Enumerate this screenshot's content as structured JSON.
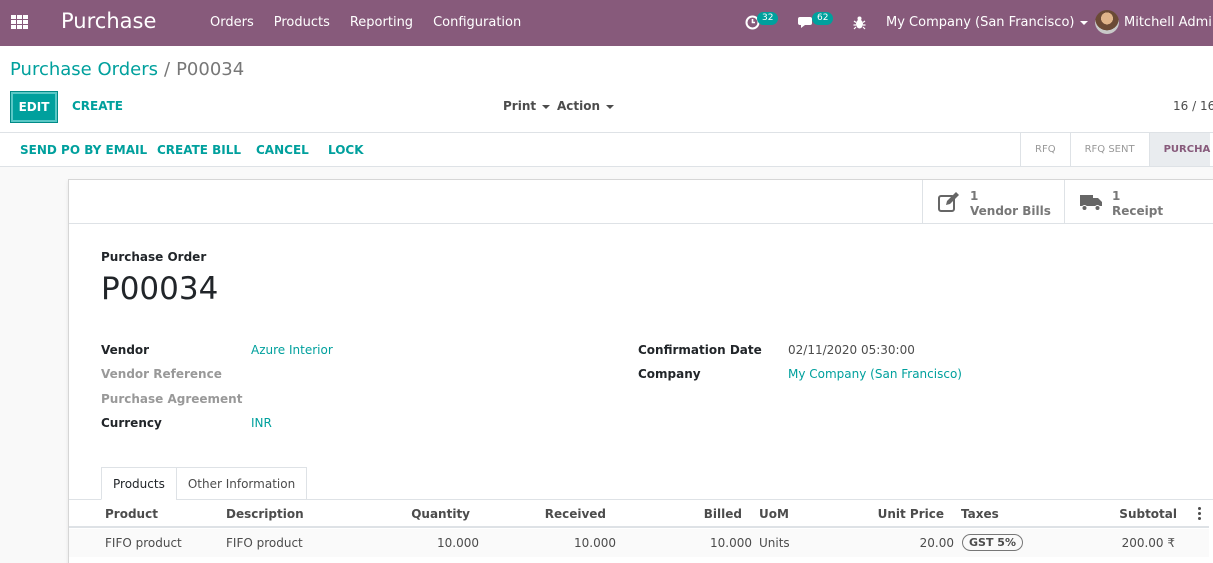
{
  "navbar": {
    "brand": "Purchase",
    "menu": [
      "Orders",
      "Products",
      "Reporting",
      "Configuration"
    ],
    "activity_count": "32",
    "message_count": "62",
    "company": "My Company (San Francisco)",
    "user": "Mitchell Admin"
  },
  "breadcrumb": {
    "parent": "Purchase Orders",
    "separator": "/",
    "current": "P00034"
  },
  "toolbar": {
    "edit": "EDIT",
    "create": "CREATE",
    "print": "Print",
    "action": "Action",
    "pager": "16 / 16"
  },
  "statusbar": {
    "buttons": [
      "SEND PO BY EMAIL",
      "CREATE BILL",
      "CANCEL",
      "LOCK"
    ],
    "stages": [
      "RFQ",
      "RFQ SENT",
      "PURCHA"
    ]
  },
  "smart_buttons": [
    {
      "count": "1",
      "label": "Vendor Bills",
      "icon": "pencil-square-icon"
    },
    {
      "count": "1",
      "label": "Receipt",
      "icon": "truck-icon"
    }
  ],
  "form": {
    "doc_type": "Purchase Order",
    "name": "P00034",
    "left_fields": [
      {
        "label": "Vendor",
        "value": "Azure Interior"
      },
      {
        "label": "Vendor Reference",
        "value": ""
      },
      {
        "label": "Purchase Agreement",
        "value": ""
      },
      {
        "label": "Currency",
        "value": "INR"
      }
    ],
    "right_fields": [
      {
        "label": "Confirmation Date",
        "value": "02/11/2020 05:30:00"
      },
      {
        "label": "Company",
        "value": "My Company (San Francisco)"
      }
    ]
  },
  "tabs": [
    "Products",
    "Other Information"
  ],
  "lines": {
    "columns": [
      "Product",
      "Description",
      "Quantity",
      "Received",
      "Billed",
      "UoM",
      "Unit Price",
      "Taxes",
      "Subtotal"
    ],
    "rows": [
      {
        "product": "FIFO product",
        "description": "FIFO product",
        "quantity": "10.000",
        "received": "10.000",
        "billed": "10.000",
        "uom": "Units",
        "unit_price": "20.00",
        "taxes": "GST 5%",
        "subtotal": "200.00 ₹"
      }
    ]
  },
  "colors": {
    "navbar": "#875a7b",
    "accent": "#00a09d"
  }
}
